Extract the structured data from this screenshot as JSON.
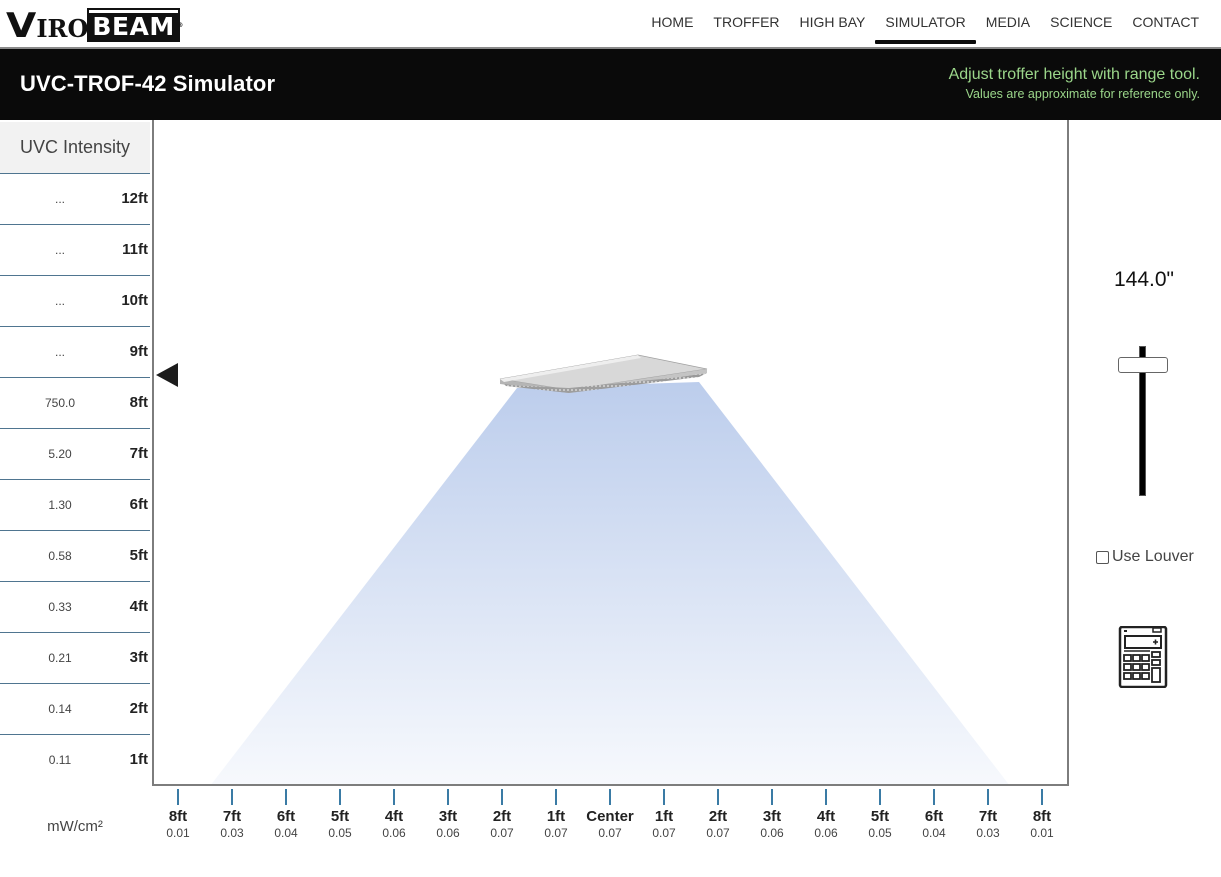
{
  "brand": {
    "logo_v": "V",
    "logo_iro": "IRO",
    "logo_beam": "BEAM",
    "logo_reg": "®"
  },
  "nav": {
    "items": [
      {
        "label": "HOME",
        "active": false
      },
      {
        "label": "TROFFER",
        "active": false
      },
      {
        "label": "HIGH BAY",
        "active": false
      },
      {
        "label": "SIMULATOR",
        "active": true
      },
      {
        "label": "MEDIA",
        "active": false
      },
      {
        "label": "SCIENCE",
        "active": false
      },
      {
        "label": "CONTACT",
        "active": false
      }
    ]
  },
  "header": {
    "title": "UVC-TROF-42 Simulator",
    "hint_primary": "Adjust troffer height with range tool.",
    "hint_secondary": "Values are approximate for reference only.",
    "hint_color": "#9bd68a"
  },
  "intensity_table": {
    "heading": "UVC Intensity",
    "unit": "mW/cm²",
    "rows": [
      {
        "height": "12ft",
        "value": "..."
      },
      {
        "height": "11ft",
        "value": "..."
      },
      {
        "height": "10ft",
        "value": "..."
      },
      {
        "height": "9ft",
        "value": "..."
      },
      {
        "height": "8ft",
        "value": "750.0"
      },
      {
        "height": "7ft",
        "value": "5.20"
      },
      {
        "height": "6ft",
        "value": "1.30"
      },
      {
        "height": "5ft",
        "value": "0.58"
      },
      {
        "height": "4ft",
        "value": "0.33"
      },
      {
        "height": "3ft",
        "value": "0.21"
      },
      {
        "height": "2ft",
        "value": "0.14"
      },
      {
        "height": "1ft",
        "value": "0.11"
      }
    ]
  },
  "floor_axis": {
    "ticks": [
      {
        "label": "8ft",
        "value": "0.01"
      },
      {
        "label": "7ft",
        "value": "0.03"
      },
      {
        "label": "6ft",
        "value": "0.04"
      },
      {
        "label": "5ft",
        "value": "0.05"
      },
      {
        "label": "4ft",
        "value": "0.06"
      },
      {
        "label": "3ft",
        "value": "0.06"
      },
      {
        "label": "2ft",
        "value": "0.07"
      },
      {
        "label": "1ft",
        "value": "0.07"
      },
      {
        "label": "Center",
        "value": "0.07"
      },
      {
        "label": "1ft",
        "value": "0.07"
      },
      {
        "label": "2ft",
        "value": "0.07"
      },
      {
        "label": "3ft",
        "value": "0.06"
      },
      {
        "label": "4ft",
        "value": "0.06"
      },
      {
        "label": "5ft",
        "value": "0.05"
      },
      {
        "label": "6ft",
        "value": "0.04"
      },
      {
        "label": "7ft",
        "value": "0.03"
      },
      {
        "label": "8ft",
        "value": "0.01"
      }
    ]
  },
  "controls": {
    "height_readout": "144.0\"",
    "height_inches": 144.0,
    "slider_fraction": 0.95,
    "louver_label": "Use Louver",
    "louver_checked": false,
    "calculator_icon": "calculator-icon"
  },
  "colors": {
    "beam_top": "#bccdec",
    "beam_bottom": "#f7f9fd",
    "header_bg": "#0a0a0a",
    "tick_color": "#3a7ba5",
    "table_divider": "#4f7590"
  }
}
